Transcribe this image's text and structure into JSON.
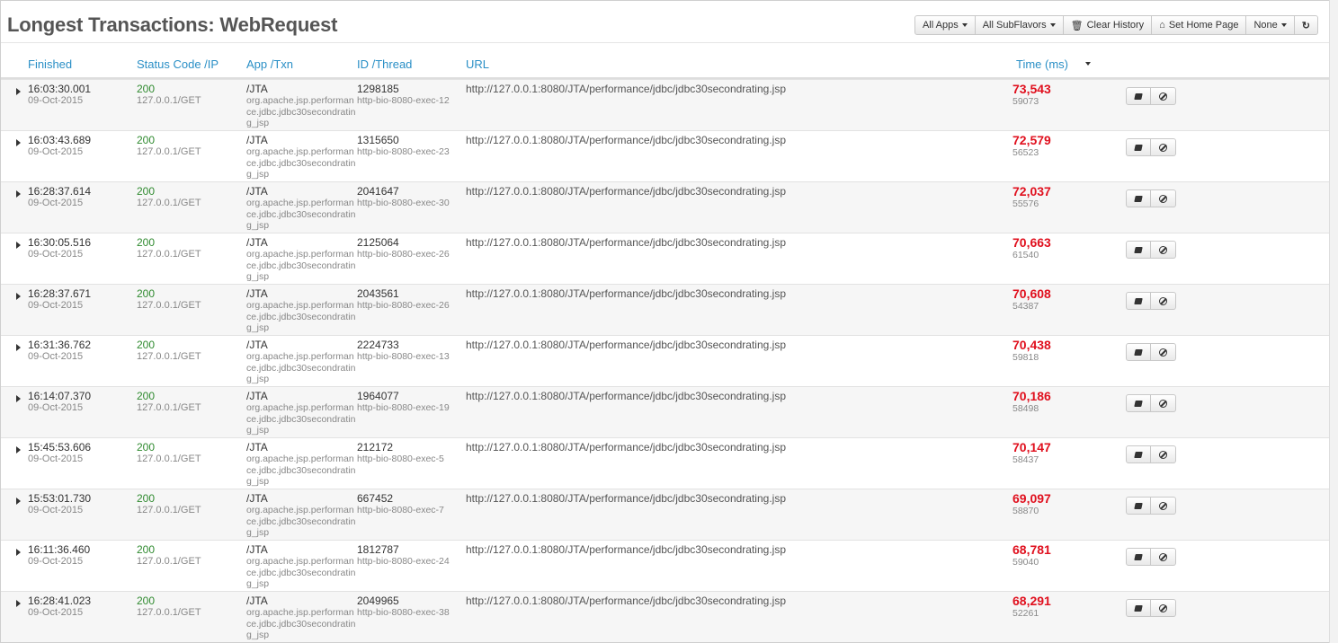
{
  "page": {
    "title": "Longest Transactions: WebRequest"
  },
  "toolbar": {
    "all_apps": "All Apps",
    "all_subflavors": "All SubFlavors",
    "clear_history": "Clear History",
    "set_home_page": "Set Home Page",
    "none": "None"
  },
  "columns": {
    "finished": "Finished",
    "status": "Status Code /IP",
    "app": "App /Txn",
    "id": "ID /Thread",
    "url": "URL",
    "time": "Time (ms)"
  },
  "colors": {
    "link": "#2a8fc6",
    "status_ok": "#2f8a2f",
    "time_red": "#e0101e"
  },
  "rows": [
    {
      "time": "16:03:30.001",
      "date": "09-Oct-2015",
      "status": "200",
      "ip": "127.0.0.1/GET",
      "app": "/JTA",
      "txn": "org.apache.jsp.performance.jdbc.jdbc30secondrating_jsp",
      "id": "1298185",
      "thread": "http-bio-8080-exec-12",
      "url": "http://127.0.0.1:8080/JTA/performance/jdbc/jdbc30secondrating.jsp",
      "ms": "73,543",
      "ms_sub": "59073"
    },
    {
      "time": "16:03:43.689",
      "date": "09-Oct-2015",
      "status": "200",
      "ip": "127.0.0.1/GET",
      "app": "/JTA",
      "txn": "org.apache.jsp.performance.jdbc.jdbc30secondrating_jsp",
      "id": "1315650",
      "thread": "http-bio-8080-exec-23",
      "url": "http://127.0.0.1:8080/JTA/performance/jdbc/jdbc30secondrating.jsp",
      "ms": "72,579",
      "ms_sub": "56523"
    },
    {
      "time": "16:28:37.614",
      "date": "09-Oct-2015",
      "status": "200",
      "ip": "127.0.0.1/GET",
      "app": "/JTA",
      "txn": "org.apache.jsp.performance.jdbc.jdbc30secondrating_jsp",
      "id": "2041647",
      "thread": "http-bio-8080-exec-30",
      "url": "http://127.0.0.1:8080/JTA/performance/jdbc/jdbc30secondrating.jsp",
      "ms": "72,037",
      "ms_sub": "55576"
    },
    {
      "time": "16:30:05.516",
      "date": "09-Oct-2015",
      "status": "200",
      "ip": "127.0.0.1/GET",
      "app": "/JTA",
      "txn": "org.apache.jsp.performance.jdbc.jdbc30secondrating_jsp",
      "id": "2125064",
      "thread": "http-bio-8080-exec-26",
      "url": "http://127.0.0.1:8080/JTA/performance/jdbc/jdbc30secondrating.jsp",
      "ms": "70,663",
      "ms_sub": "61540"
    },
    {
      "time": "16:28:37.671",
      "date": "09-Oct-2015",
      "status": "200",
      "ip": "127.0.0.1/GET",
      "app": "/JTA",
      "txn": "org.apache.jsp.performance.jdbc.jdbc30secondrating_jsp",
      "id": "2043561",
      "thread": "http-bio-8080-exec-26",
      "url": "http://127.0.0.1:8080/JTA/performance/jdbc/jdbc30secondrating.jsp",
      "ms": "70,608",
      "ms_sub": "54387"
    },
    {
      "time": "16:31:36.762",
      "date": "09-Oct-2015",
      "status": "200",
      "ip": "127.0.0.1/GET",
      "app": "/JTA",
      "txn": "org.apache.jsp.performance.jdbc.jdbc30secondrating_jsp",
      "id": "2224733",
      "thread": "http-bio-8080-exec-13",
      "url": "http://127.0.0.1:8080/JTA/performance/jdbc/jdbc30secondrating.jsp",
      "ms": "70,438",
      "ms_sub": "59818"
    },
    {
      "time": "16:14:07.370",
      "date": "09-Oct-2015",
      "status": "200",
      "ip": "127.0.0.1/GET",
      "app": "/JTA",
      "txn": "org.apache.jsp.performance.jdbc.jdbc30secondrating_jsp",
      "id": "1964077",
      "thread": "http-bio-8080-exec-19",
      "url": "http://127.0.0.1:8080/JTA/performance/jdbc/jdbc30secondrating.jsp",
      "ms": "70,186",
      "ms_sub": "58498"
    },
    {
      "time": "15:45:53.606",
      "date": "09-Oct-2015",
      "status": "200",
      "ip": "127.0.0.1/GET",
      "app": "/JTA",
      "txn": "org.apache.jsp.performance.jdbc.jdbc30secondrating_jsp",
      "id": "212172",
      "thread": "http-bio-8080-exec-5",
      "url": "http://127.0.0.1:8080/JTA/performance/jdbc/jdbc30secondrating.jsp",
      "ms": "70,147",
      "ms_sub": "58437"
    },
    {
      "time": "15:53:01.730",
      "date": "09-Oct-2015",
      "status": "200",
      "ip": "127.0.0.1/GET",
      "app": "/JTA",
      "txn": "org.apache.jsp.performance.jdbc.jdbc30secondrating_jsp",
      "id": "667452",
      "thread": "http-bio-8080-exec-7",
      "url": "http://127.0.0.1:8080/JTA/performance/jdbc/jdbc30secondrating.jsp",
      "ms": "69,097",
      "ms_sub": "58870"
    },
    {
      "time": "16:11:36.460",
      "date": "09-Oct-2015",
      "status": "200",
      "ip": "127.0.0.1/GET",
      "app": "/JTA",
      "txn": "org.apache.jsp.performance.jdbc.jdbc30secondrating_jsp",
      "id": "1812787",
      "thread": "http-bio-8080-exec-24",
      "url": "http://127.0.0.1:8080/JTA/performance/jdbc/jdbc30secondrating.jsp",
      "ms": "68,781",
      "ms_sub": "59040"
    },
    {
      "time": "16:28:41.023",
      "date": "09-Oct-2015",
      "status": "200",
      "ip": "127.0.0.1/GET",
      "app": "/JTA",
      "txn": "org.apache.jsp.performance.jdbc.jdbc30secondrating_jsp",
      "id": "2049965",
      "thread": "http-bio-8080-exec-38",
      "url": "http://127.0.0.1:8080/JTA/performance/jdbc/jdbc30secondrating.jsp",
      "ms": "68,291",
      "ms_sub": "52261"
    }
  ]
}
